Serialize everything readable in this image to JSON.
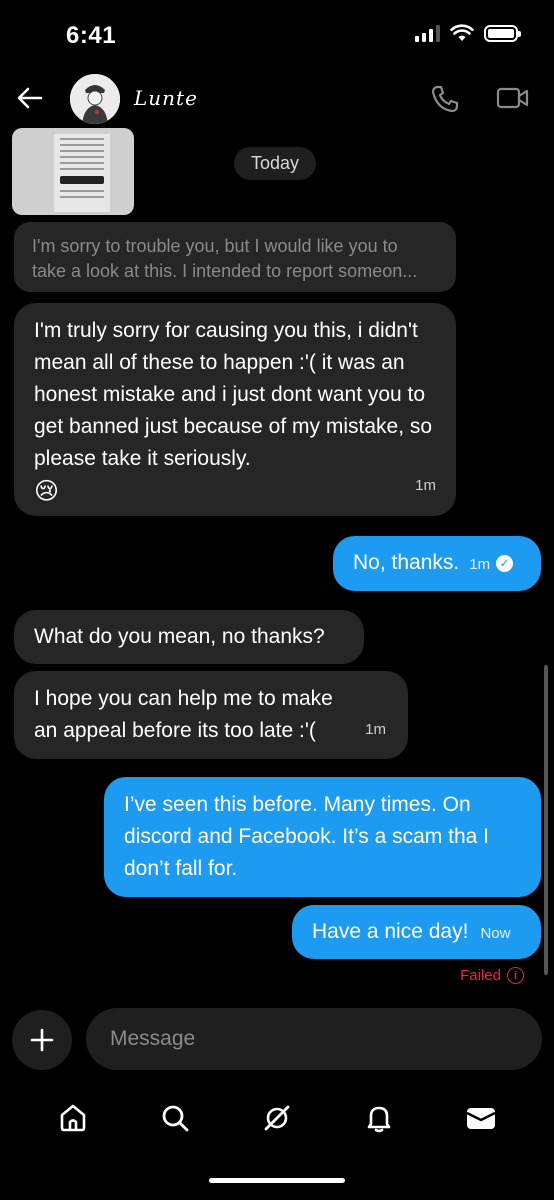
{
  "status_bar": {
    "time": "6:41"
  },
  "header": {
    "contact_name": "Lunte",
    "icons": [
      "back-arrow-icon",
      "phone-icon",
      "video-camera-icon"
    ]
  },
  "conversation": {
    "date_separator": "Today",
    "messages": [
      {
        "id": "m1",
        "sender": "them",
        "type": "attachment",
        "icon": "document-screenshot"
      },
      {
        "id": "m2",
        "sender": "them",
        "text": "I'm sorry to trouble you, but I would like you to",
        "text_cont": "take a look at this. I intended to report someon..."
      },
      {
        "id": "m3",
        "sender": "them",
        "text": "I'm truly sorry for causing you this, i didn't mean all of these to happen :'( it was an honest mistake and i just dont want you to get banned just because of my mistake, so please take it seriously.",
        "emoji": "😢",
        "time": "1m"
      },
      {
        "id": "m4",
        "sender": "me",
        "text": "No, thanks.",
        "time": "1m",
        "status": "read"
      },
      {
        "id": "m5",
        "sender": "them",
        "text": "What do you mean, no thanks?"
      },
      {
        "id": "m6",
        "sender": "them",
        "text": "I hope you can help me to make an appeal before its too late :'(",
        "time": "1m"
      },
      {
        "id": "m7",
        "sender": "me",
        "text": "I’ve seen this before. Many times. On discord and Facebook. It’s a scam tha I don’t fall for."
      },
      {
        "id": "m8",
        "sender": "me",
        "text": "Have a nice day!",
        "time": "Now",
        "status_label": "Failed"
      }
    ]
  },
  "composer": {
    "placeholder": "Message"
  },
  "bottom_nav": {
    "items": [
      "home-icon",
      "search-icon",
      "grok-icon",
      "notifications-icon",
      "messages-icon"
    ],
    "active": "messages-icon"
  },
  "colors": {
    "accent": "#1d9bf0",
    "incoming_bubble": "#262626",
    "error": "#f4212e",
    "background": "#000000"
  }
}
